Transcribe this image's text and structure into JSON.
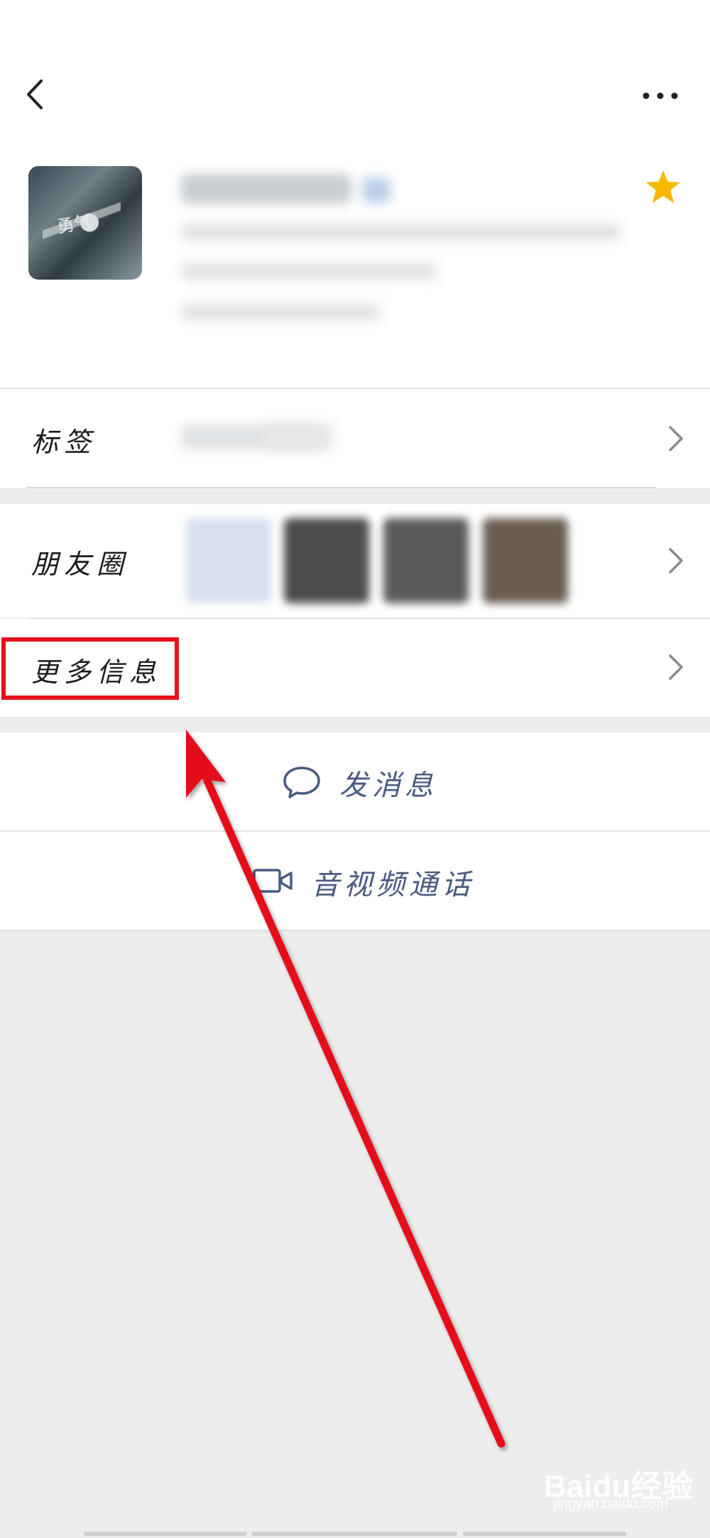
{
  "profile": {
    "starred": true,
    "colors": {
      "star": "#f9b800",
      "accent_text": "#4a5a80",
      "highlight": "#e5101a"
    }
  },
  "rows": {
    "tags_label": "标签",
    "moments_label": "朋友圈",
    "more_info_label": "更多信息"
  },
  "actions": {
    "message_label": "发消息",
    "video_call_label": "音视频通话"
  },
  "watermark": {
    "brand": "Baidu经验",
    "url": "jingyan.baidu.com"
  }
}
